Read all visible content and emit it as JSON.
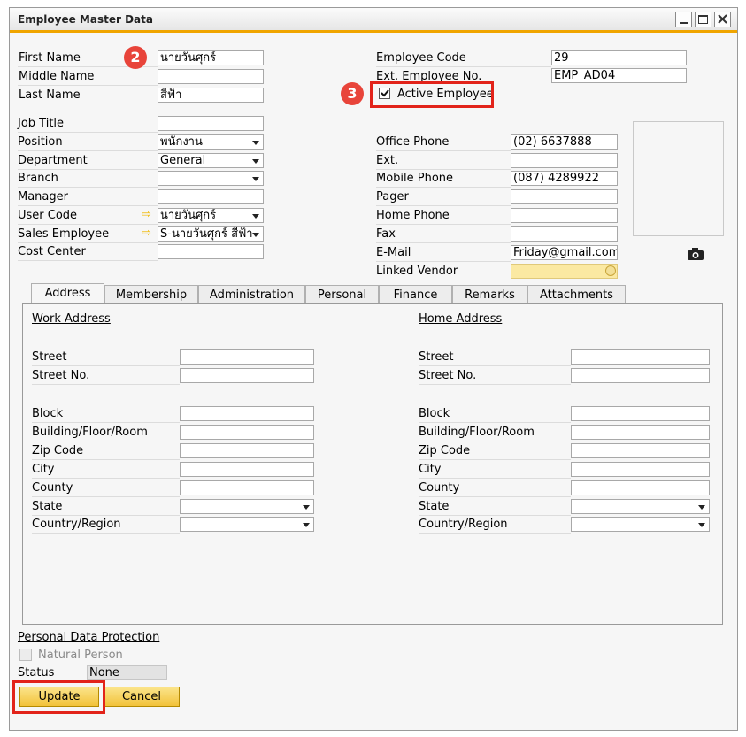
{
  "window": {
    "title": "Employee Master Data"
  },
  "header_left": [
    {
      "label": "First Name",
      "value": "นายวันศุกร์"
    },
    {
      "label": "Middle Name",
      "value": ""
    },
    {
      "label": "Last Name",
      "value": "สีฟ้า"
    }
  ],
  "header_right": {
    "employee_code_label": "Employee Code",
    "employee_code": "29",
    "ext_emp_label": "Ext. Employee No.",
    "ext_emp": "EMP_AD04",
    "active_label": "Active Employee"
  },
  "org_fields": [
    {
      "label": "Job Title",
      "value": "",
      "dropdown": false
    },
    {
      "label": "Position",
      "value": "พนักงาน",
      "dropdown": true
    },
    {
      "label": "Department",
      "value": "General",
      "dropdown": true
    },
    {
      "label": "Branch",
      "value": "",
      "dropdown": true
    },
    {
      "label": "Manager",
      "value": "",
      "dropdown": false
    },
    {
      "label": "User Code",
      "value": "นายวันศุกร์",
      "dropdown": true
    },
    {
      "label": "Sales Employee",
      "value": "S-นายวันศุกร์ สีฟ้า",
      "dropdown": true
    },
    {
      "label": "Cost Center",
      "value": "",
      "dropdown": false
    }
  ],
  "contact_fields": [
    {
      "label": "Office Phone",
      "value": "(02) 6637888"
    },
    {
      "label": "Ext.",
      "value": ""
    },
    {
      "label": "Mobile Phone",
      "value": "(087) 4289922"
    },
    {
      "label": "Pager",
      "value": ""
    },
    {
      "label": "Home Phone",
      "value": ""
    },
    {
      "label": "Fax",
      "value": ""
    },
    {
      "label": "E-Mail",
      "value": "Friday@gmail.com"
    },
    {
      "label": "Linked Vendor",
      "value": ""
    }
  ],
  "tabs": [
    "Address",
    "Membership",
    "Administration",
    "Personal",
    "Finance",
    "Remarks",
    "Attachments"
  ],
  "address": {
    "work_title": "Work Address",
    "home_title": "Home Address",
    "rows": [
      "Street",
      "Street No.",
      "Block",
      "Building/Floor/Room",
      "Zip Code",
      "City",
      "County",
      "State",
      "Country/Region"
    ]
  },
  "pdp": {
    "title": "Personal Data Protection",
    "natural_person": "Natural Person",
    "status_label": "Status",
    "status_value": "None"
  },
  "buttons": {
    "update": "Update",
    "cancel": "Cancel"
  },
  "callouts": {
    "first": "2",
    "second": "3"
  },
  "colors": {
    "accent": "#f0a500",
    "callout": "#e8443a",
    "highlight": "#e2231a",
    "button": "#f2c23a"
  }
}
